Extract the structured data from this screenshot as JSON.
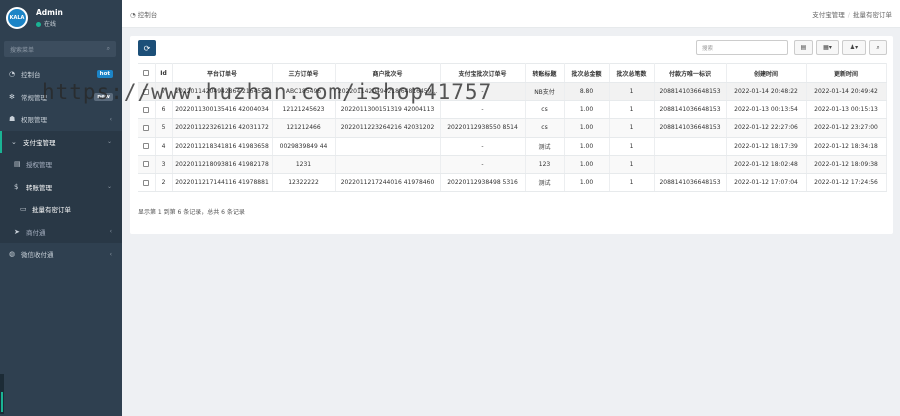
{
  "user": {
    "name": "Admin",
    "status": "在线",
    "logo_text": "KALA"
  },
  "sidebar": {
    "search_placeholder": "搜索菜单",
    "items": [
      {
        "label": "控制台",
        "icon": "dashboard-icon",
        "badge": "hot"
      },
      {
        "label": "常规管理",
        "icon": "gear-icon",
        "badge": "new"
      },
      {
        "label": "权限管理",
        "icon": "group-icon",
        "arrow": "‹"
      },
      {
        "label": "支付宝管理",
        "icon": "chevron-down-icon",
        "arrow": "⌄"
      },
      {
        "label": "授权管理",
        "icon": "list-icon"
      },
      {
        "label": "转账管理",
        "icon": "dollar-icon",
        "arrow": "⌄"
      },
      {
        "label": "批量有密订单",
        "icon": "card-icon"
      },
      {
        "label": "商付通",
        "icon": "send-icon",
        "arrow": "‹"
      },
      {
        "label": "微信收付通",
        "icon": "wechat-icon",
        "arrow": "‹"
      }
    ]
  },
  "topbar": {
    "home": "控制台",
    "crumb_1": "支付宝管理",
    "crumb_2": "批量有密订单"
  },
  "toolbar": {
    "search_placeholder": "搜索"
  },
  "table": {
    "columns": [
      "Id",
      "平台订单号",
      "三方订单号",
      "商户批次号",
      "支付宝批次订单号",
      "转账标题",
      "批次总金额",
      "批次总笔数",
      "付款方唯一标识",
      "创建时间",
      "更新时间"
    ],
    "rows": [
      [
        "7",
        "20220114204942864 2164558",
        "ABC185496",
        "2022011420494218 64816459...",
        "-",
        "NB支付",
        "8.80",
        "1",
        "2088141036648153",
        "2022-01-14 20:48:22",
        "2022-01-14 20:49:42"
      ],
      [
        "6",
        "2022011300135416 42004034",
        "12121245623",
        "2022011300151319 42004113",
        "-",
        "cs",
        "1.00",
        "1",
        "2088141036648153",
        "2022-01-13 00:13:54",
        "2022-01-13 00:15:13"
      ],
      [
        "5",
        "2022011223261216 42031172",
        "121212466",
        "2022011223264216 42031202",
        "20220112938550 8514",
        "cs",
        "1.00",
        "1",
        "2088141036648153",
        "2022-01-12 22:27:06",
        "2022-01-12 23:27:00"
      ],
      [
        "4",
        "2022011218341816 41983658",
        "0029839849 44",
        "",
        "-",
        "测试",
        "1.00",
        "1",
        "",
        "2022-01-12 18:17:39",
        "2022-01-12 18:34:18"
      ],
      [
        "3",
        "2022011218093816 41982178",
        "1231",
        "",
        "-",
        "123",
        "1.00",
        "1",
        "",
        "2022-01-12 18:02:48",
        "2022-01-12 18:09:38"
      ],
      [
        "2",
        "2022011217144116 41978881",
        "12322222",
        "2022011217244016 41978460",
        "20220112938498 5316",
        "测试",
        "1.00",
        "1",
        "2088141036648153",
        "2022-01-12 17:07:04",
        "2022-01-12 17:24:56"
      ]
    ]
  },
  "footer": {
    "summary": "显示第 1 到第 6 条记录，总共 6 条记录"
  },
  "watermark": "https://www.huzhan.com/ishop41757"
}
